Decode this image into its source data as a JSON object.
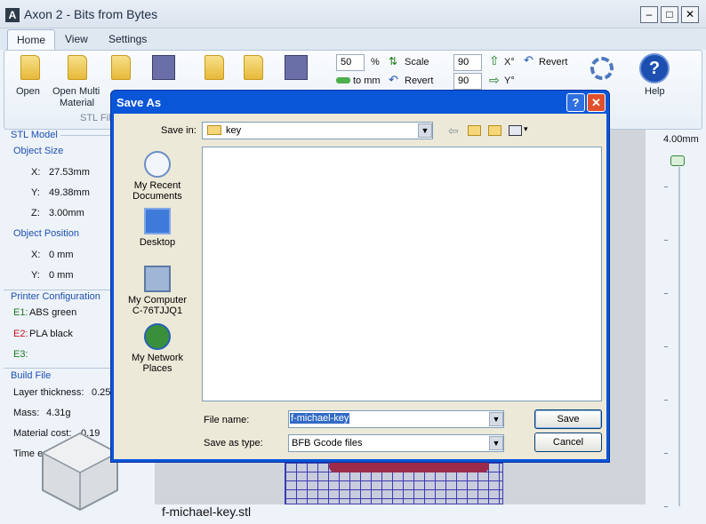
{
  "window": {
    "title": "Axon 2 - Bits from Bytes",
    "controls": {
      "minimize": "–",
      "maximize": "□",
      "close": "✕"
    }
  },
  "tabs": [
    "Home",
    "View",
    "Settings"
  ],
  "ribbon": {
    "open": "Open",
    "open_multi": "Open Multi",
    "open_multi_2": "Material",
    "stl_files_label": "STL Fil",
    "scale_value": "50",
    "percent": "%",
    "scale_label": "Scale",
    "to_mm_label": "to mm",
    "revert1": "Revert",
    "rot_x_value": "90",
    "x_label": "X°",
    "rot_y_value": "90",
    "y_label": "Y°",
    "revert2": "Revert",
    "help": "Help"
  },
  "left_panel": {
    "stl_model": "STL Model",
    "object_size": "Object Size",
    "size_x_label": "X:",
    "size_x": "27.53mm",
    "size_y_label": "Y:",
    "size_y": "49.38mm",
    "size_z_label": "Z:",
    "size_z": "3.00mm",
    "object_position": "Object Position",
    "pos_x_label": "X:",
    "pos_x": "0 mm",
    "pos_y_label": "Y:",
    "pos_y": "0 mm",
    "printer_config": "Printer Configuration",
    "e1_label": "E1:",
    "e1": "ABS green",
    "e2_label": "E2:",
    "e2": "PLA black",
    "e3_label": "E3:",
    "build_file": "Build File",
    "layer_thickness_label": "Layer thickness:",
    "layer_thickness": "0.25",
    "mass_label": "Mass:",
    "mass": "4.31g",
    "material_cost_label": "Material cost:",
    "material_cost": "0.19",
    "time_est_label": "Time est"
  },
  "slider": {
    "top_label": "4.00mm"
  },
  "view": {
    "filename": "f-michael-key.stl"
  },
  "dialog": {
    "title": "Save As",
    "help_btn": "?",
    "close_btn": "✕",
    "save_in_label": "Save in:",
    "save_in_value": "key",
    "places": [
      {
        "label1": "My Recent",
        "label2": "Documents"
      },
      {
        "label1": "Desktop",
        "label2": ""
      },
      {
        "label1": "My Computer",
        "label2": "C-76TJJQ1"
      },
      {
        "label1": "My Network",
        "label2": "Places"
      }
    ],
    "file_name_label": "File name:",
    "file_name_value": "f-michael-key",
    "save_as_type_label": "Save as type:",
    "save_as_type_value": "BFB Gcode files",
    "save_button": "Save",
    "cancel_button": "Cancel"
  },
  "colors": {
    "dialog_title": "#0a56d8",
    "accent_blue": "#1c4fb0",
    "e1": "#1a7a1a",
    "e2": "#c0141c",
    "e3": "#1a7a1a"
  }
}
